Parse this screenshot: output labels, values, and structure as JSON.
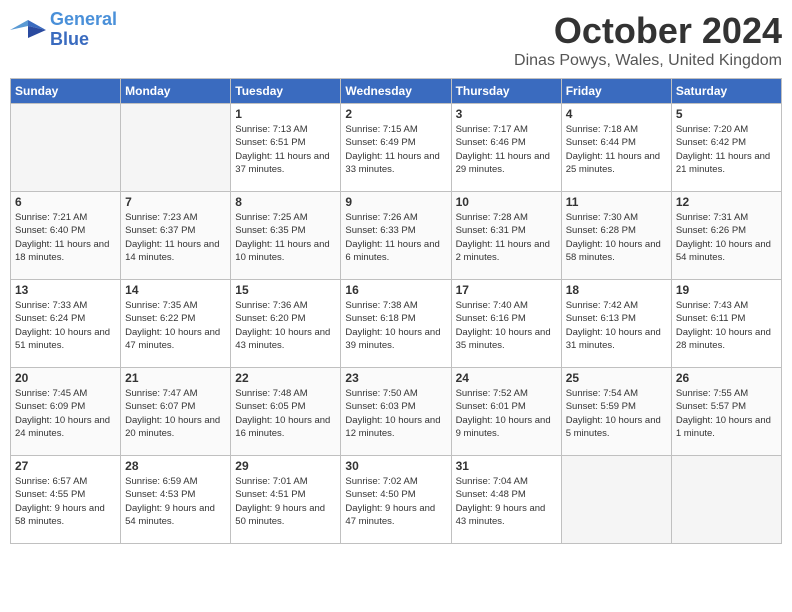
{
  "logo": {
    "line1": "General",
    "line2": "Blue"
  },
  "title": "October 2024",
  "subtitle": "Dinas Powys, Wales, United Kingdom",
  "weekdays": [
    "Sunday",
    "Monday",
    "Tuesday",
    "Wednesday",
    "Thursday",
    "Friday",
    "Saturday"
  ],
  "weeks": [
    [
      {
        "day": "",
        "empty": true
      },
      {
        "day": "",
        "empty": true
      },
      {
        "day": "1",
        "sunrise": "7:13 AM",
        "sunset": "6:51 PM",
        "daylight": "11 hours and 37 minutes."
      },
      {
        "day": "2",
        "sunrise": "7:15 AM",
        "sunset": "6:49 PM",
        "daylight": "11 hours and 33 minutes."
      },
      {
        "day": "3",
        "sunrise": "7:17 AM",
        "sunset": "6:46 PM",
        "daylight": "11 hours and 29 minutes."
      },
      {
        "day": "4",
        "sunrise": "7:18 AM",
        "sunset": "6:44 PM",
        "daylight": "11 hours and 25 minutes."
      },
      {
        "day": "5",
        "sunrise": "7:20 AM",
        "sunset": "6:42 PM",
        "daylight": "11 hours and 21 minutes."
      }
    ],
    [
      {
        "day": "6",
        "sunrise": "7:21 AM",
        "sunset": "6:40 PM",
        "daylight": "11 hours and 18 minutes."
      },
      {
        "day": "7",
        "sunrise": "7:23 AM",
        "sunset": "6:37 PM",
        "daylight": "11 hours and 14 minutes."
      },
      {
        "day": "8",
        "sunrise": "7:25 AM",
        "sunset": "6:35 PM",
        "daylight": "11 hours and 10 minutes."
      },
      {
        "day": "9",
        "sunrise": "7:26 AM",
        "sunset": "6:33 PM",
        "daylight": "11 hours and 6 minutes."
      },
      {
        "day": "10",
        "sunrise": "7:28 AM",
        "sunset": "6:31 PM",
        "daylight": "11 hours and 2 minutes."
      },
      {
        "day": "11",
        "sunrise": "7:30 AM",
        "sunset": "6:28 PM",
        "daylight": "10 hours and 58 minutes."
      },
      {
        "day": "12",
        "sunrise": "7:31 AM",
        "sunset": "6:26 PM",
        "daylight": "10 hours and 54 minutes."
      }
    ],
    [
      {
        "day": "13",
        "sunrise": "7:33 AM",
        "sunset": "6:24 PM",
        "daylight": "10 hours and 51 minutes."
      },
      {
        "day": "14",
        "sunrise": "7:35 AM",
        "sunset": "6:22 PM",
        "daylight": "10 hours and 47 minutes."
      },
      {
        "day": "15",
        "sunrise": "7:36 AM",
        "sunset": "6:20 PM",
        "daylight": "10 hours and 43 minutes."
      },
      {
        "day": "16",
        "sunrise": "7:38 AM",
        "sunset": "6:18 PM",
        "daylight": "10 hours and 39 minutes."
      },
      {
        "day": "17",
        "sunrise": "7:40 AM",
        "sunset": "6:16 PM",
        "daylight": "10 hours and 35 minutes."
      },
      {
        "day": "18",
        "sunrise": "7:42 AM",
        "sunset": "6:13 PM",
        "daylight": "10 hours and 31 minutes."
      },
      {
        "day": "19",
        "sunrise": "7:43 AM",
        "sunset": "6:11 PM",
        "daylight": "10 hours and 28 minutes."
      }
    ],
    [
      {
        "day": "20",
        "sunrise": "7:45 AM",
        "sunset": "6:09 PM",
        "daylight": "10 hours and 24 minutes."
      },
      {
        "day": "21",
        "sunrise": "7:47 AM",
        "sunset": "6:07 PM",
        "daylight": "10 hours and 20 minutes."
      },
      {
        "day": "22",
        "sunrise": "7:48 AM",
        "sunset": "6:05 PM",
        "daylight": "10 hours and 16 minutes."
      },
      {
        "day": "23",
        "sunrise": "7:50 AM",
        "sunset": "6:03 PM",
        "daylight": "10 hours and 12 minutes."
      },
      {
        "day": "24",
        "sunrise": "7:52 AM",
        "sunset": "6:01 PM",
        "daylight": "10 hours and 9 minutes."
      },
      {
        "day": "25",
        "sunrise": "7:54 AM",
        "sunset": "5:59 PM",
        "daylight": "10 hours and 5 minutes."
      },
      {
        "day": "26",
        "sunrise": "7:55 AM",
        "sunset": "5:57 PM",
        "daylight": "10 hours and 1 minute."
      }
    ],
    [
      {
        "day": "27",
        "sunrise": "6:57 AM",
        "sunset": "4:55 PM",
        "daylight": "9 hours and 58 minutes."
      },
      {
        "day": "28",
        "sunrise": "6:59 AM",
        "sunset": "4:53 PM",
        "daylight": "9 hours and 54 minutes."
      },
      {
        "day": "29",
        "sunrise": "7:01 AM",
        "sunset": "4:51 PM",
        "daylight": "9 hours and 50 minutes."
      },
      {
        "day": "30",
        "sunrise": "7:02 AM",
        "sunset": "4:50 PM",
        "daylight": "9 hours and 47 minutes."
      },
      {
        "day": "31",
        "sunrise": "7:04 AM",
        "sunset": "4:48 PM",
        "daylight": "9 hours and 43 minutes."
      },
      {
        "day": "",
        "empty": true
      },
      {
        "day": "",
        "empty": true
      }
    ]
  ]
}
